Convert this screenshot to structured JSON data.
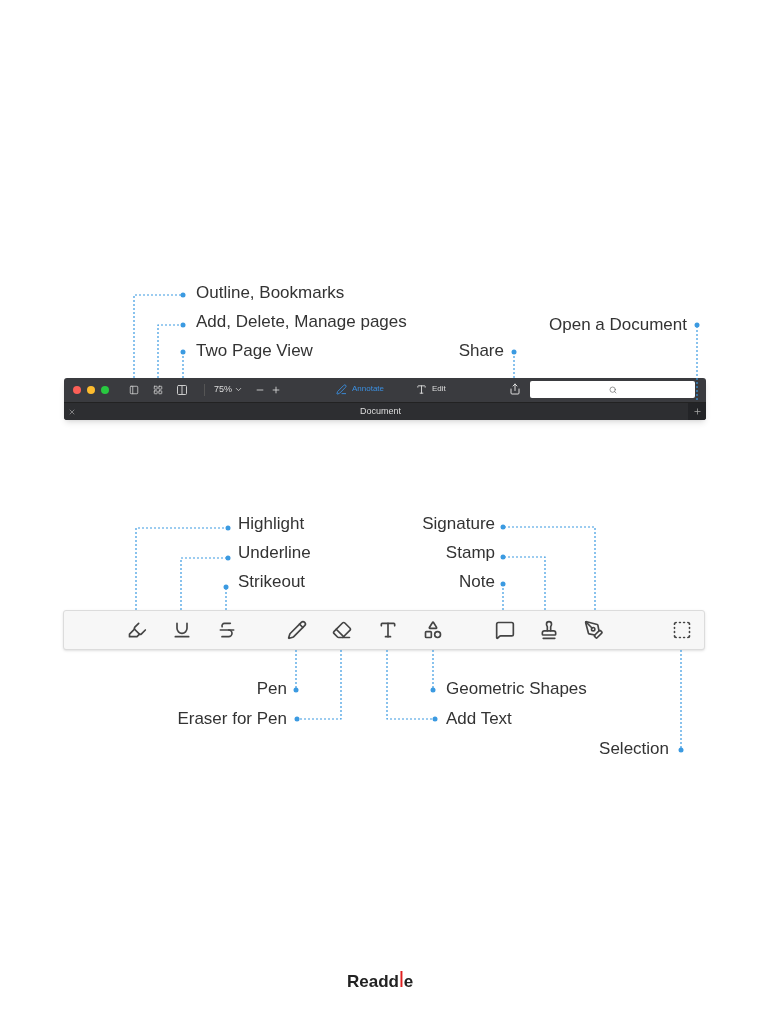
{
  "window_toolbar": {
    "zoom": "75%",
    "modes": [
      {
        "label": "Annotate",
        "selected": true
      },
      {
        "label": "Edit",
        "selected": false
      }
    ],
    "tab_title": "Document"
  },
  "annotation_toolbar": {
    "tools": [
      {
        "kind": "highlight"
      },
      {
        "kind": "underline"
      },
      {
        "kind": "strikeout"
      },
      {
        "kind": "pen"
      },
      {
        "kind": "eraser"
      },
      {
        "kind": "text"
      },
      {
        "kind": "shapes"
      },
      {
        "kind": "note"
      },
      {
        "kind": "stamp"
      },
      {
        "kind": "signature"
      },
      {
        "kind": "selection"
      }
    ]
  },
  "callouts": [
    {
      "label": "Outline, Bookmarks"
    },
    {
      "label": "Add, Delete, Manage pages"
    },
    {
      "label": "Two Page View"
    },
    {
      "label": "Share"
    },
    {
      "label": "Open a Document"
    },
    {
      "label": "Highlight"
    },
    {
      "label": "Underline"
    },
    {
      "label": "Strikeout"
    },
    {
      "label": "Signature"
    },
    {
      "label": "Stamp"
    },
    {
      "label": "Note"
    },
    {
      "label": "Pen"
    },
    {
      "label": "Eraser for Pen"
    },
    {
      "label": "Geometric Shapes"
    },
    {
      "label": "Add Text"
    },
    {
      "label": "Selection"
    }
  ],
  "logo": "Readdle"
}
